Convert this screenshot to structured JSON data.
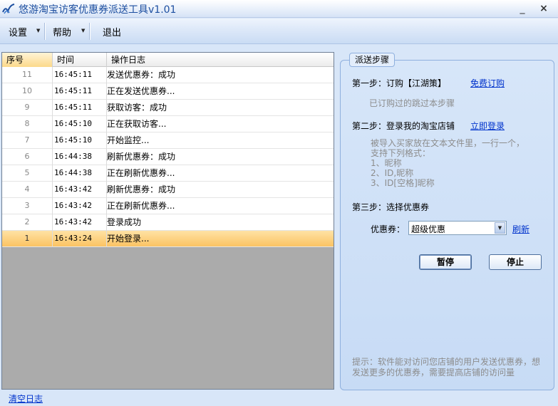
{
  "window": {
    "title": "悠游淘宝访客优惠券派送工具v1.01",
    "min_glyph": "_",
    "close_glyph": "×"
  },
  "toolbar": {
    "settings_label": "设置",
    "help_label": "帮助",
    "exit_label": "退出",
    "dropdown_glyph": "▼"
  },
  "log": {
    "headers": {
      "no": "序号",
      "time": "时间",
      "log": "操作日志"
    },
    "rows": [
      {
        "no": "11",
        "time": "16:45:11",
        "log": "发送优惠券：成功"
      },
      {
        "no": "10",
        "time": "16:45:11",
        "log": "正在发送优惠券..."
      },
      {
        "no": "9",
        "time": "16:45:11",
        "log": "获取访客：成功"
      },
      {
        "no": "8",
        "time": "16:45:10",
        "log": "正在获取访客..."
      },
      {
        "no": "7",
        "time": "16:45:10",
        "log": "开始监控..."
      },
      {
        "no": "6",
        "time": "16:44:38",
        "log": "刷新优惠券：成功"
      },
      {
        "no": "5",
        "time": "16:44:38",
        "log": "正在刷新优惠券..."
      },
      {
        "no": "4",
        "time": "16:43:42",
        "log": "刷新优惠券：成功"
      },
      {
        "no": "3",
        "time": "16:43:42",
        "log": "正在刷新优惠券..."
      },
      {
        "no": "2",
        "time": "16:43:42",
        "log": "登录成功"
      },
      {
        "no": "1",
        "time": "16:43:24",
        "log": "开始登录..."
      }
    ],
    "clear_label": "清空日志"
  },
  "steps": {
    "legend": "派送步骤",
    "step1": {
      "label": "第一步：订购【江湖策】",
      "link": "免费订购",
      "note": "已订购过的跳过本步骤"
    },
    "step2": {
      "label": "第二步：登录我的淘宝店铺",
      "link": "立即登录",
      "hint": "被导入买家放在文本文件里，一行一个，\n支持下列格式：\n1、昵称\n2、ID,昵称\n3、ID[空格]昵称"
    },
    "step3": {
      "label": "第三步：选择优惠券",
      "coupon_label": "优惠券：",
      "coupon_value": "超级优惠",
      "refresh_link": "刷新"
    },
    "pause_label": "暂停",
    "stop_label": "停止",
    "tip": "提示：软件能对访问您店铺的用户发送优惠券，想发送更多的优惠券，需要提高店铺的访问量"
  }
}
